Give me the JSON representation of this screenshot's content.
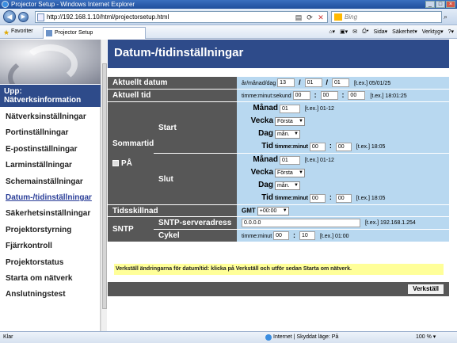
{
  "window": {
    "title": "Projector Setup - Windows Internet Explorer"
  },
  "browser": {
    "url_host": "http://192.168.1.10",
    "url_path": "/html/projectorsetup.html",
    "search_placeholder": "Bing",
    "favorites_label": "Favoriter",
    "tab_title": "Projector Setup",
    "tools": {
      "page": "Sida",
      "safety": "Säkerhet",
      "tools": "Verktyg",
      "help": "?"
    }
  },
  "sidebar": {
    "up_label": "Upp:\nNätverksinformation",
    "items": [
      {
        "label": "Nätverksinställningar"
      },
      {
        "label": "Portinställningar"
      },
      {
        "label": "E-postinställningar"
      },
      {
        "label": "Larminställningar"
      },
      {
        "label": "Schemainställningar"
      },
      {
        "label": "Datum-/tidinställningar",
        "active": true
      },
      {
        "label": "Säkerhetsinställningar"
      },
      {
        "label": "Projektorstyrning"
      },
      {
        "label": "Fjärrkontroll"
      },
      {
        "label": "Projektorstatus"
      },
      {
        "label": "Starta om nätverk"
      },
      {
        "label": "Anslutningstest"
      }
    ]
  },
  "page": {
    "title": "Datum-/tidinställningar"
  },
  "rows": {
    "date": {
      "label": "Aktuellt datum",
      "format": "år/månad/dag",
      "year": "13",
      "month": "01",
      "day": "01",
      "sep": "/",
      "example": "[t.ex.] 05/01/25"
    },
    "time": {
      "label": "Aktuell tid",
      "format": "timme:minut:sekund",
      "h": "00",
      "m": "00",
      "s": "00",
      "sep": ":",
      "example": "[t.ex.] 18:01:25"
    },
    "dst": {
      "label": "Sommartid",
      "enable_label": "PÅ",
      "start": {
        "label": "Start",
        "month_label": "Månad",
        "month": "01",
        "month_ex": "[t.ex.] 01-12",
        "week_label": "Vecka",
        "week": "Första",
        "day_label": "Dag",
        "day": "mån.",
        "time_label": "Tid",
        "time_format": "timme:minut",
        "h": "00",
        "m": "00",
        "sep": ":",
        "time_ex": "[t.ex.] 18:05"
      },
      "end": {
        "label": "Slut",
        "month_label": "Månad",
        "month": "01",
        "month_ex": "[t.ex.] 01-12",
        "week_label": "Vecka",
        "week": "Första",
        "day_label": "Dag",
        "day": "mån.",
        "time_label": "Tid",
        "time_format": "timme:minut",
        "h": "00",
        "m": "00",
        "sep": ":",
        "time_ex": "[t.ex.] 18:05"
      }
    },
    "tz": {
      "label": "Tidsskillnad",
      "prefix": "GMT",
      "value": "+00:00"
    },
    "sntp": {
      "label": "SNTP",
      "server_label": "SNTP-serveradress",
      "server": "0.0.0.0",
      "server_ex": "[t.ex.] 192.168.1.254",
      "cycle_label": "Cykel",
      "cycle_format": "timme:minut",
      "h": "00",
      "m": "10",
      "sep": ":",
      "cycle_ex": "[t.ex.] 01:00"
    }
  },
  "notice": "Verkställ ändringarna för datum/tid: klicka på Verkställ och utför sedan Starta om nätverk.",
  "apply_label": "Verkställ",
  "statusbar": {
    "left": "Klar",
    "zone": "Internet | Skyddat läge: På",
    "zoom": "100 %"
  },
  "colors": {
    "header": "#2e4b8a",
    "label_bg": "#575757",
    "value_bg": "#b8d8f0",
    "notice_bg": "#ffff99"
  }
}
